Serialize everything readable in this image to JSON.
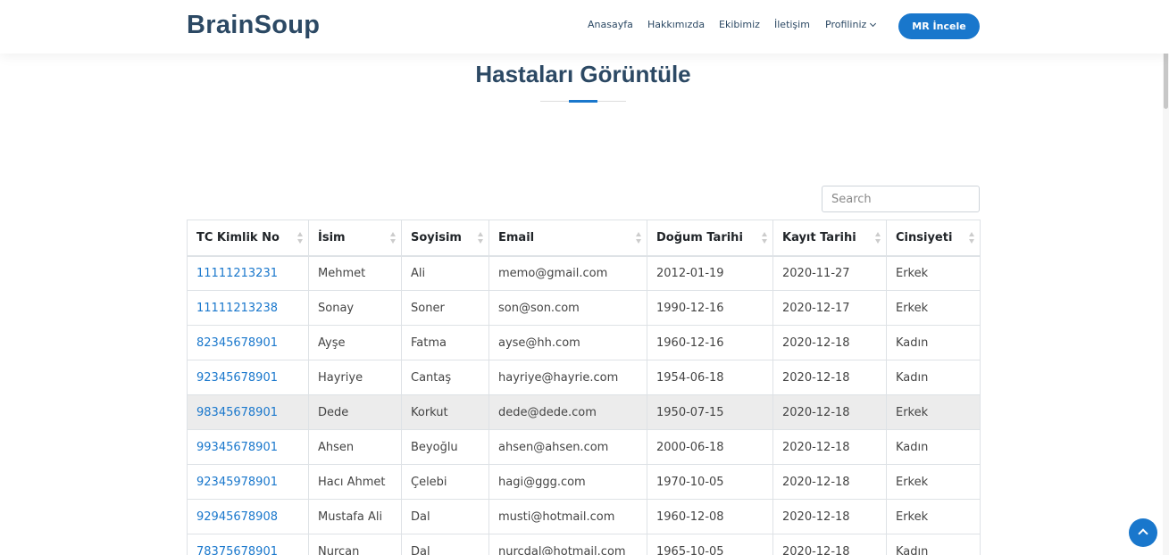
{
  "brand": {
    "name": "BrainSoup"
  },
  "nav": {
    "items": [
      "Anasayfa",
      "Hakkımızda",
      "Ekibimiz",
      "İletişim",
      "Profiliniz"
    ],
    "cta_label": "MR İncele"
  },
  "page": {
    "title": "Hastaları Görüntüle"
  },
  "search": {
    "placeholder": "Search",
    "value": ""
  },
  "table": {
    "headers": [
      "TC Kimlik No",
      "İsim",
      "Soyisim",
      "Email",
      "Doğum Tarihi",
      "Kayıt Tarihi",
      "Cinsiyeti"
    ],
    "rows": [
      [
        "11111213231",
        "Mehmet",
        "Ali",
        "memo@gmail.com",
        "2012-01-19",
        "2020-11-27",
        "Erkek"
      ],
      [
        "11111213238",
        "Sonay",
        "Soner",
        "son@son.com",
        "1990-12-16",
        "2020-12-17",
        "Erkek"
      ],
      [
        "82345678901",
        "Ayşe",
        "Fatma",
        "ayse@hh.com",
        "1960-12-16",
        "2020-12-18",
        "Kadın"
      ],
      [
        "92345678901",
        "Hayriye",
        "Cantaş",
        "hayriye@hayrie.com",
        "1954-06-18",
        "2020-12-18",
        "Kadın"
      ],
      [
        "98345678901",
        "Dede",
        "Korkut",
        "dede@dede.com",
        "1950-07-15",
        "2020-12-18",
        "Erkek"
      ],
      [
        "99345678901",
        "Ahsen",
        "Beyoğlu",
        "ahsen@ahsen.com",
        "2000-06-18",
        "2020-12-18",
        "Kadın"
      ],
      [
        "92345978901",
        "Hacı Ahmet",
        "Çelebi",
        "hagi@ggg.com",
        "1970-10-05",
        "2020-12-18",
        "Erkek"
      ],
      [
        "92945678908",
        "Mustafa Ali",
        "Dal",
        "musti@hotmail.com",
        "1960-12-08",
        "2020-12-18",
        "Erkek"
      ],
      [
        "78375678901",
        "Nurcan",
        "Dal",
        "nurcdal@hotmail.com",
        "1965-10-05",
        "2020-12-18",
        "Kadın"
      ]
    ]
  },
  "colors": {
    "accent": "#1977cc",
    "heading": "#2c4964",
    "row_highlight": "#ececec"
  },
  "icons": {
    "dropdown": "chevron-down-icon",
    "sort": "sort-icon",
    "back_to_top": "arrow-up-icon"
  }
}
